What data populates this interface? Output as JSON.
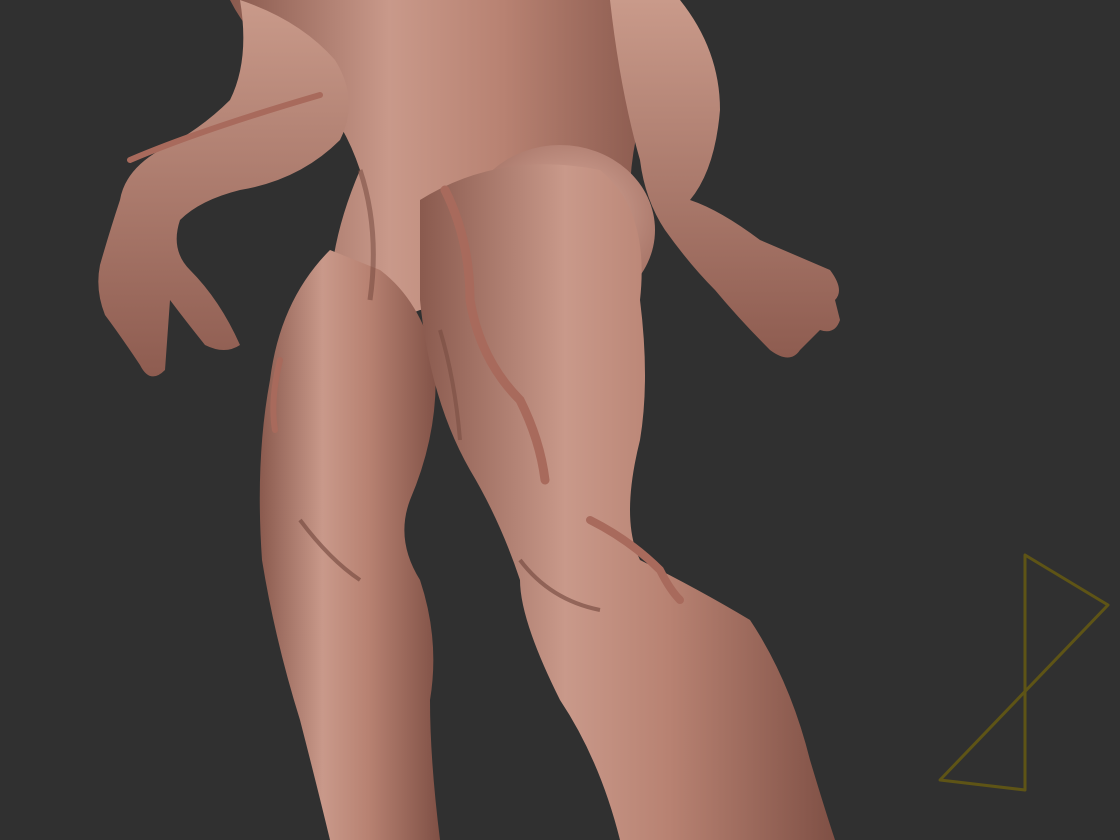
{
  "viewport": {
    "background_color": "#303030",
    "subject": "sculpted-creature-lower-body",
    "skin_color": "#c08a7a",
    "skin_shadow_color": "#7a4c42",
    "skin_highlight_color": "#e0b3a4",
    "vein_color": "#a86a5c"
  },
  "gizmo": {
    "icon": "transform-gizmo-icon",
    "color": "#5e5416"
  }
}
